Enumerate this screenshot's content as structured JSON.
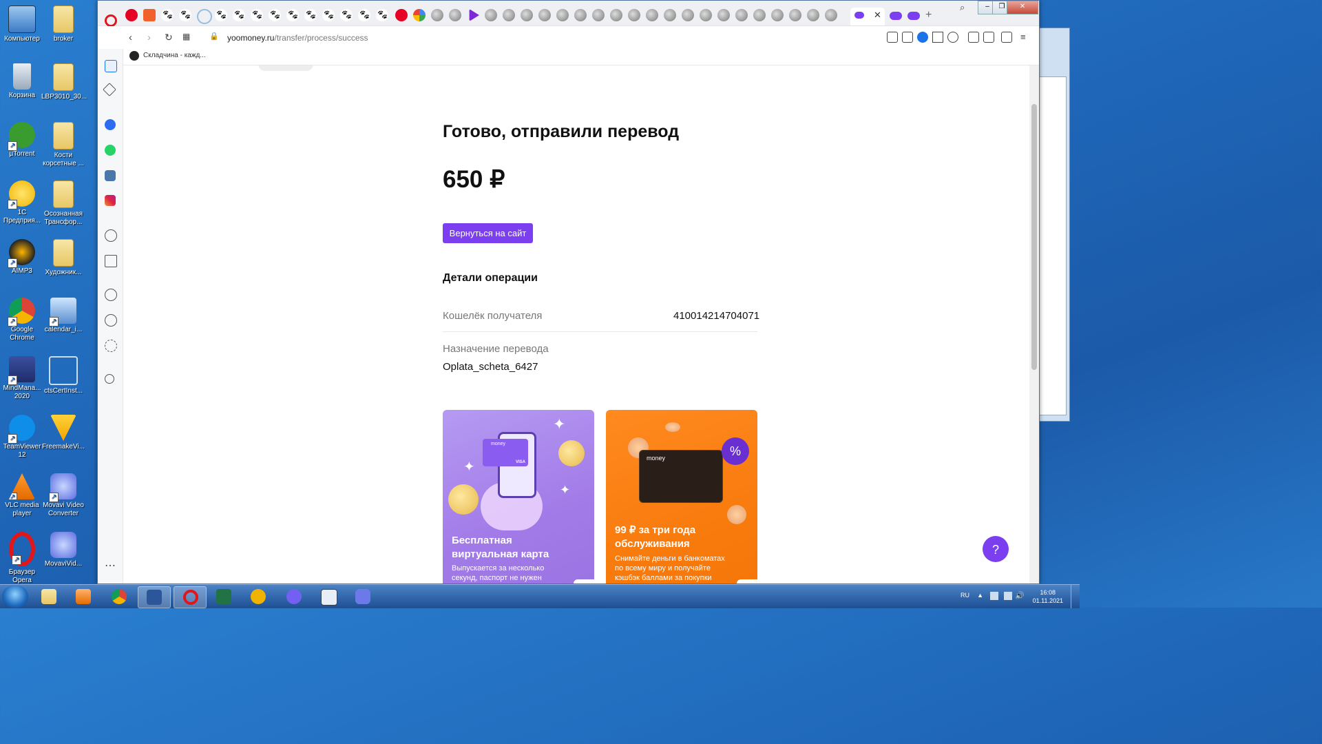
{
  "desktop": {
    "icons": [
      {
        "label": "Компьютер"
      },
      {
        "label": "broker"
      },
      {
        "label": "Корзина"
      },
      {
        "label": "LBP3010_30..."
      },
      {
        "label": "µTorrent"
      },
      {
        "label": "Кости корсетные ..."
      },
      {
        "label": "1С Предприя..."
      },
      {
        "label": "Осознанная Трансфор..."
      },
      {
        "label": "AIMP3"
      },
      {
        "label": "Художник..."
      },
      {
        "label": "Google Chrome"
      },
      {
        "label": "calendar_i..."
      },
      {
        "label": "MindMana... 2020"
      },
      {
        "label": "ctsCertInst..."
      },
      {
        "label": "TeamViewer 12"
      },
      {
        "label": "FreemakeVi..."
      },
      {
        "label": "VLC media player"
      },
      {
        "label": "Movavi Video Converter"
      },
      {
        "label": "Браузер Opera"
      },
      {
        "label": "MovaviVid..."
      }
    ]
  },
  "browser": {
    "address": {
      "domain": "yoomoney.ru",
      "path": "/transfer/process/success"
    },
    "bookmark": "Складчина - кажд..."
  },
  "page": {
    "title": "Готово, отправили перевод",
    "amount": "650 ₽",
    "back_button": "Вернуться на сайт",
    "details_title": "Детали операции",
    "wallet_label": "Кошелёк получателя",
    "wallet_value": "410014214704071",
    "purpose_label": "Назначение перевода",
    "purpose_value": "Oplata_scheta_6427",
    "promo_cards": [
      {
        "title": "Бесплатная виртуальная карта",
        "desc": "Выпускается за несколько секунд, паспорт не нужен"
      },
      {
        "title": "99 ₽ за три года обслуживания",
        "desc": "Снимайте деньги в банкоматах по всему миру и получайте кэшбэк баллами за покупки"
      }
    ],
    "help_button": "?",
    "card_brand": "money",
    "badge": "%",
    "visa": "VISA"
  },
  "taskbar": {
    "lang": "RU",
    "time": "16:08",
    "date": "01.11.2021"
  },
  "colors": {
    "accent": "#7b3ff0",
    "orange": "#f97c0f",
    "purple_card": "#a27be8"
  }
}
